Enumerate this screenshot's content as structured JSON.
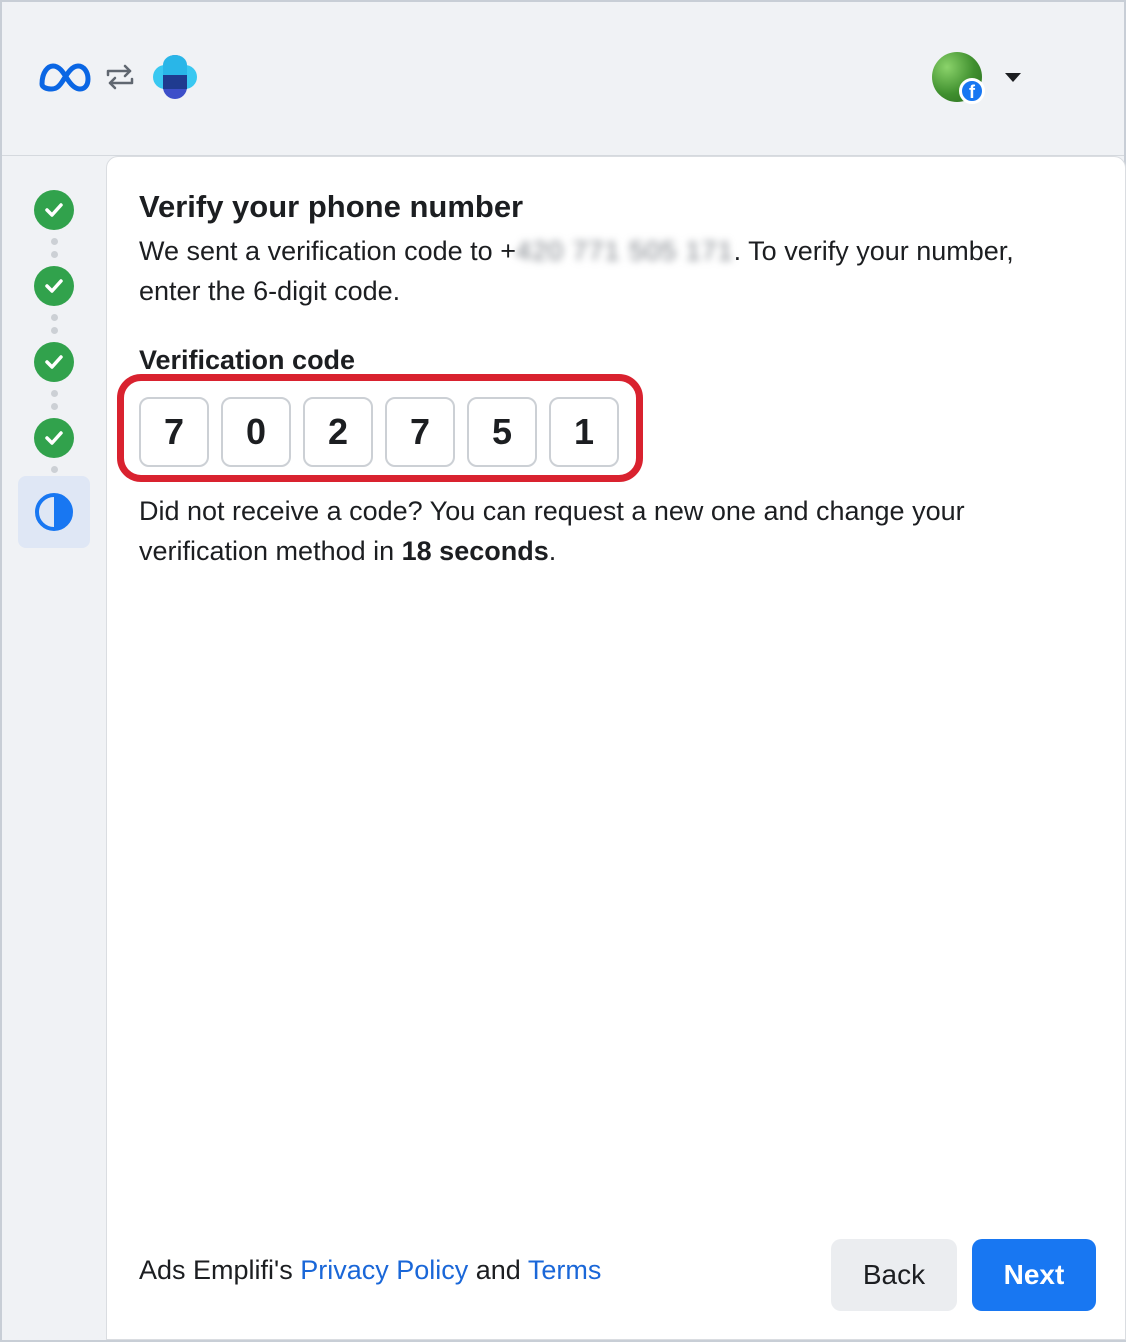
{
  "header": {
    "meta_logo": "meta-logo-icon",
    "swap_icon": "swap-arrows-icon",
    "app_icon": "emplifi-app-icon",
    "avatar_badge": "f"
  },
  "stepper": {
    "completed_steps": 4,
    "current_step": 5,
    "colors": {
      "done": "#31a24c",
      "current_bg": "#dfe7f5",
      "current_icon": "#1877f2"
    }
  },
  "main": {
    "title": "Verify your phone number",
    "desc_prefix": "We sent a verification code to +",
    "phone_masked": "420 771 505 171",
    "desc_suffix": ". To verify your number, enter the 6-digit code.",
    "code_label": "Verification code",
    "digits": [
      "7",
      "0",
      "2",
      "7",
      "5",
      "1"
    ],
    "resend_prefix": "Did not receive a code? You can request a new one and change your verification method in ",
    "resend_time": "18 seconds",
    "resend_suffix": "."
  },
  "footer": {
    "prefix": "Ads Emplifi's ",
    "privacy_link": "Privacy Policy",
    "and": " and ",
    "terms_link": "Terms",
    "back_label": "Back",
    "next_label": "Next"
  },
  "colors": {
    "accent": "#1877f2",
    "highlight": "#d9222f",
    "link": "#1a67d8"
  }
}
